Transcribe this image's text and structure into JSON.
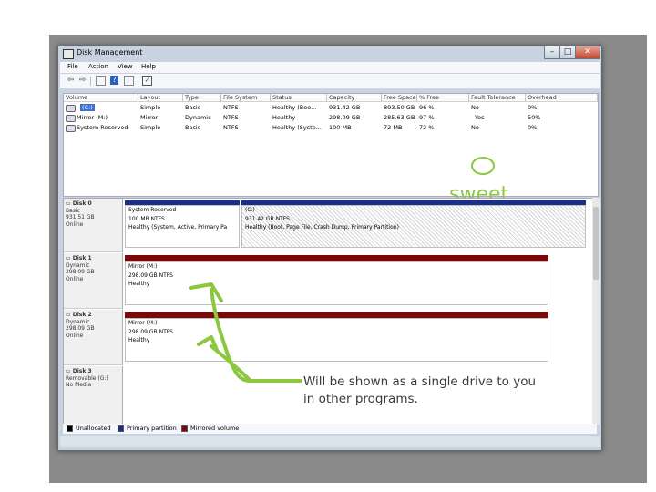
{
  "window": {
    "title": "Disk Management",
    "min_glyph": "–",
    "max_glyph": "□",
    "close_glyph": "✕"
  },
  "menu": [
    "File",
    "Action",
    "View",
    "Help"
  ],
  "toolbar_icons": [
    "back-icon",
    "forward-icon",
    "properties-icon",
    "help-icon",
    "refresh-icon",
    "console-icon"
  ],
  "volume_table": {
    "headers": [
      "Volume",
      "Layout",
      "Type",
      "File System",
      "Status",
      "Capacity",
      "Free Space",
      "% Free",
      "Fault Tolerance",
      "Overhead"
    ],
    "rows": [
      [
        "(C:)",
        "Simple",
        "Basic",
        "NTFS",
        "Healthy (Boo...",
        "931.42 GB",
        "893.50 GB",
        "96 %",
        "No",
        "0%"
      ],
      [
        "Mirror (M:)",
        "Mirror",
        "Dynamic",
        "NTFS",
        "Healthy",
        "298.09 GB",
        "285.63 GB",
        "97 %",
        "Yes",
        "50%"
      ],
      [
        "System Reserved",
        "Simple",
        "Basic",
        "NTFS",
        "Healthy (Syste...",
        "100 MB",
        "72 MB",
        "72 %",
        "No",
        "0%"
      ]
    ]
  },
  "annotations": {
    "sweet": "sweet",
    "note_line1": "Will be shown as a single drive to you",
    "note_line2": "in other programs.",
    "accent_color": "#8dc63f"
  },
  "disks": [
    {
      "name": "Disk 0",
      "type": "Basic",
      "size": "931.51 GB",
      "status": "Online",
      "partitions": [
        {
          "title": "System Reserved",
          "size": "100 MB NTFS",
          "status": "Healthy (System, Active, Primary Pa"
        },
        {
          "title": "(C:)",
          "size": "931.42 GB NTFS",
          "status": "Healthy (Boot, Page File, Crash Dump, Primary Partition)"
        }
      ]
    },
    {
      "name": "Disk 1",
      "type": "Dynamic",
      "size": "298.09 GB",
      "status": "Online",
      "partitions": [
        {
          "title": "Mirror (M:)",
          "size": "298.09 GB NTFS",
          "status": "Healthy"
        }
      ]
    },
    {
      "name": "Disk 2",
      "type": "Dynamic",
      "size": "298.09 GB",
      "status": "Online",
      "partitions": [
        {
          "title": "Mirror (M:)",
          "size": "298.09 GB NTFS",
          "status": "Healthy"
        }
      ]
    },
    {
      "name": "Disk 3",
      "type": "Removable (G:)",
      "size": "",
      "status": "No Media",
      "partitions": []
    }
  ],
  "legend": [
    {
      "label": "Unallocated",
      "color": "#000000"
    },
    {
      "label": "Primary partition",
      "color": "#1a2e8c"
    },
    {
      "label": "Mirrored volume",
      "color": "#7a0a0a"
    }
  ]
}
